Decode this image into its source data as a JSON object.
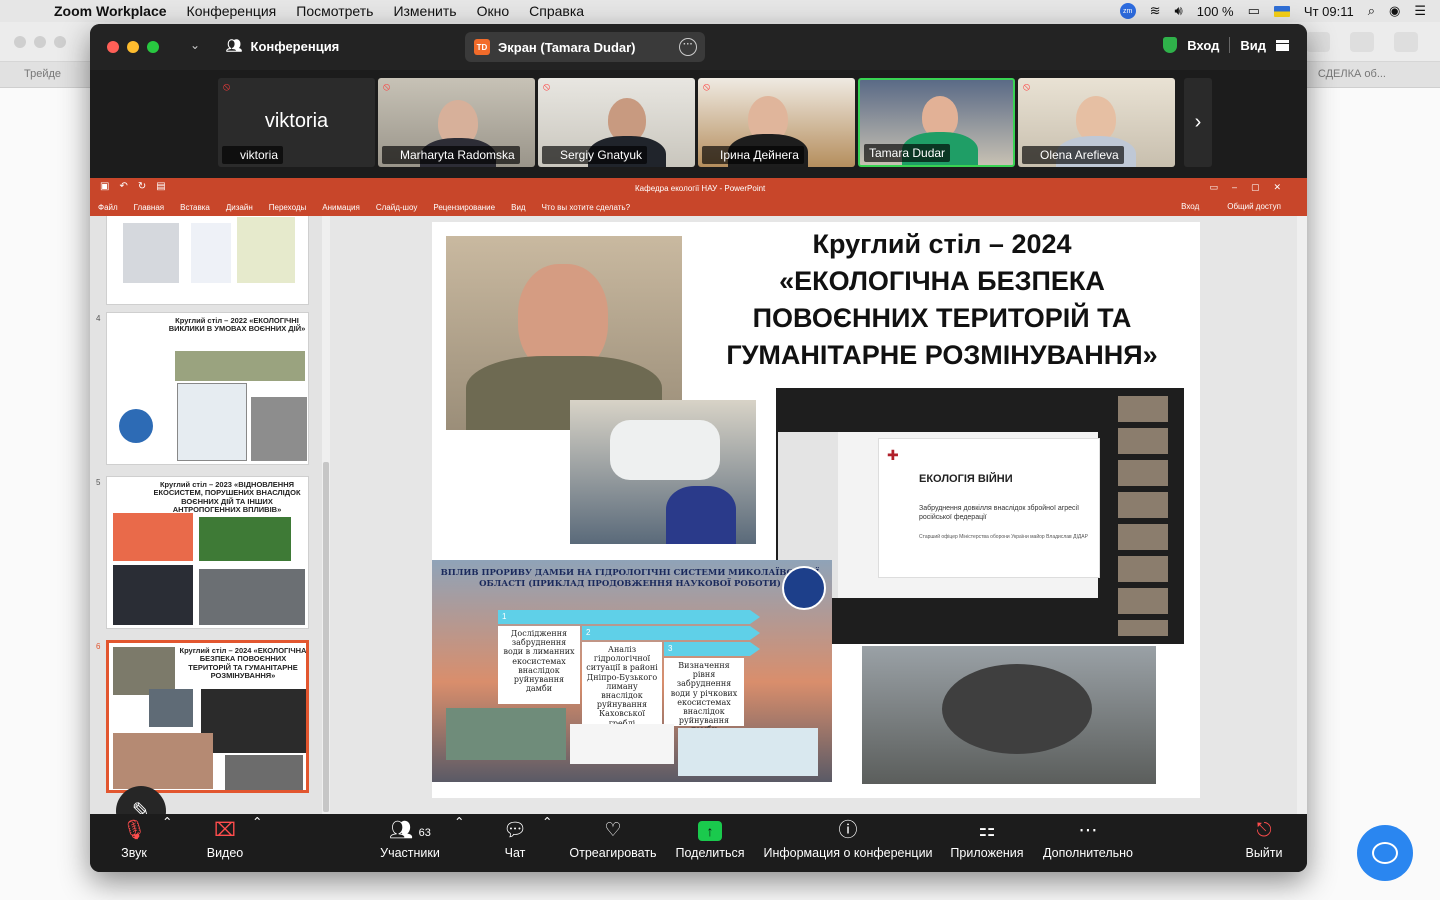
{
  "menubar": {
    "app": "Zoom Workplace",
    "items": [
      "Конференция",
      "Посмотреть",
      "Изменить",
      "Окно",
      "Справка"
    ],
    "zm": "zm",
    "battery": "100 %",
    "clock": "Чт 09:11"
  },
  "browser": {
    "tab_left": "Трейде",
    "tab_right": "СДЕЛКА об..."
  },
  "zoom": {
    "title": "Конференция",
    "screen_badge": "TD",
    "screen_label": "Экран (Tamara Dudar)",
    "signin": "Вход",
    "view": "Вид"
  },
  "participants": [
    {
      "name": "viktoria",
      "display": "viktoria",
      "muted": true
    },
    {
      "name": "Marharyta Radomska",
      "muted": true
    },
    {
      "name": "Sergiy Gnatyuk",
      "muted": true
    },
    {
      "name": "Ірина Дейнега",
      "muted": true
    },
    {
      "name": "Tamara Dudar",
      "muted": false,
      "active": true
    },
    {
      "name": "Olena Arefieva",
      "muted": true
    }
  ],
  "ppt": {
    "title": "Кафедра екології НАУ - PowerPoint",
    "ribbon": [
      "Файл",
      "Главная",
      "Вставка",
      "Дизайн",
      "Переходы",
      "Анимация",
      "Слайд-шоу",
      "Рецензирование",
      "Вид"
    ],
    "tell_me": "Что вы хотите сделать?",
    "signin": "Вход",
    "share": "Общий доступ",
    "thumbs": [
      {
        "num": "4",
        "title": "Круглий стіл – 2022 «ЕКОЛОГІЧНІ ВИКЛИКИ В УМОВАХ ВОЄННИХ ДІЙ»"
      },
      {
        "num": "5",
        "title": "Круглий стіл – 2023 «ВІДНОВЛЕННЯ ЕКОСИСТЕМ, ПОРУШЕНИХ ВНАСЛІДОК ВОЄННИХ ДІЙ ТА ІНШИХ АНТРОПОГЕННИХ ВПЛИВІВ»"
      },
      {
        "num": "6",
        "title": "Круглий стіл – 2024 «ЕКОЛОГІЧНА БЕЗПЕКА ПОВОЄННИХ ТЕРИТОРІЙ ТА ГУМАНІТАРНЕ РОЗМІНУВАННЯ»"
      }
    ],
    "slide": {
      "title_lines": [
        "Круглий стіл – 2024",
        "«ЕКОЛОГІЧНА БЕЗПЕКА",
        "ПОВОЄННИХ ТЕРИТОРІЙ ТА",
        "ГУМАНІТАРНЕ РОЗМІНУВАННЯ»"
      ],
      "inner_heading": "ЕКОЛОГІЯ ВІЙНИ",
      "inner_sub": "Забруднення довкілля внаслідок збройної агресії російської федерації",
      "inner_author": "Старший офіцер Міністерства оборони України майор Владислав ДІДАР",
      "dam_title": "ВПЛИВ ПРОРИВУ ДАМБИ НА ГІДРОЛОГІЧНІ СИСТЕМИ МИКОЛАЇВСЬКОЇ ОБЛАСТІ (ПРИКЛАД ПРОДОВЖЕННЯ НАУКОВОЇ РОБОТИ)",
      "steps": [
        {
          "n": "1",
          "text": "Дослідження забруднення води в лиманних екосистемах внаслідок руйнування дамби"
        },
        {
          "n": "2",
          "text": "Аналіз гідрологічної ситуації в районі Дніпро-Бузького лиману внаслідок руйнування Каховської греблі"
        },
        {
          "n": "3",
          "text": "Визначення рівня забруднення води у річкових екосистемах внаслідок руйнування дамби"
        }
      ]
    }
  },
  "toolbar": {
    "audio": "Звук",
    "video": "Видео",
    "participants": "Участники",
    "participants_count": "63",
    "chat": "Чат",
    "react": "Отреагировать",
    "share": "Поделиться",
    "info": "Информация о конференции",
    "apps": "Приложения",
    "more": "Дополнительно",
    "leave": "Выйти"
  }
}
